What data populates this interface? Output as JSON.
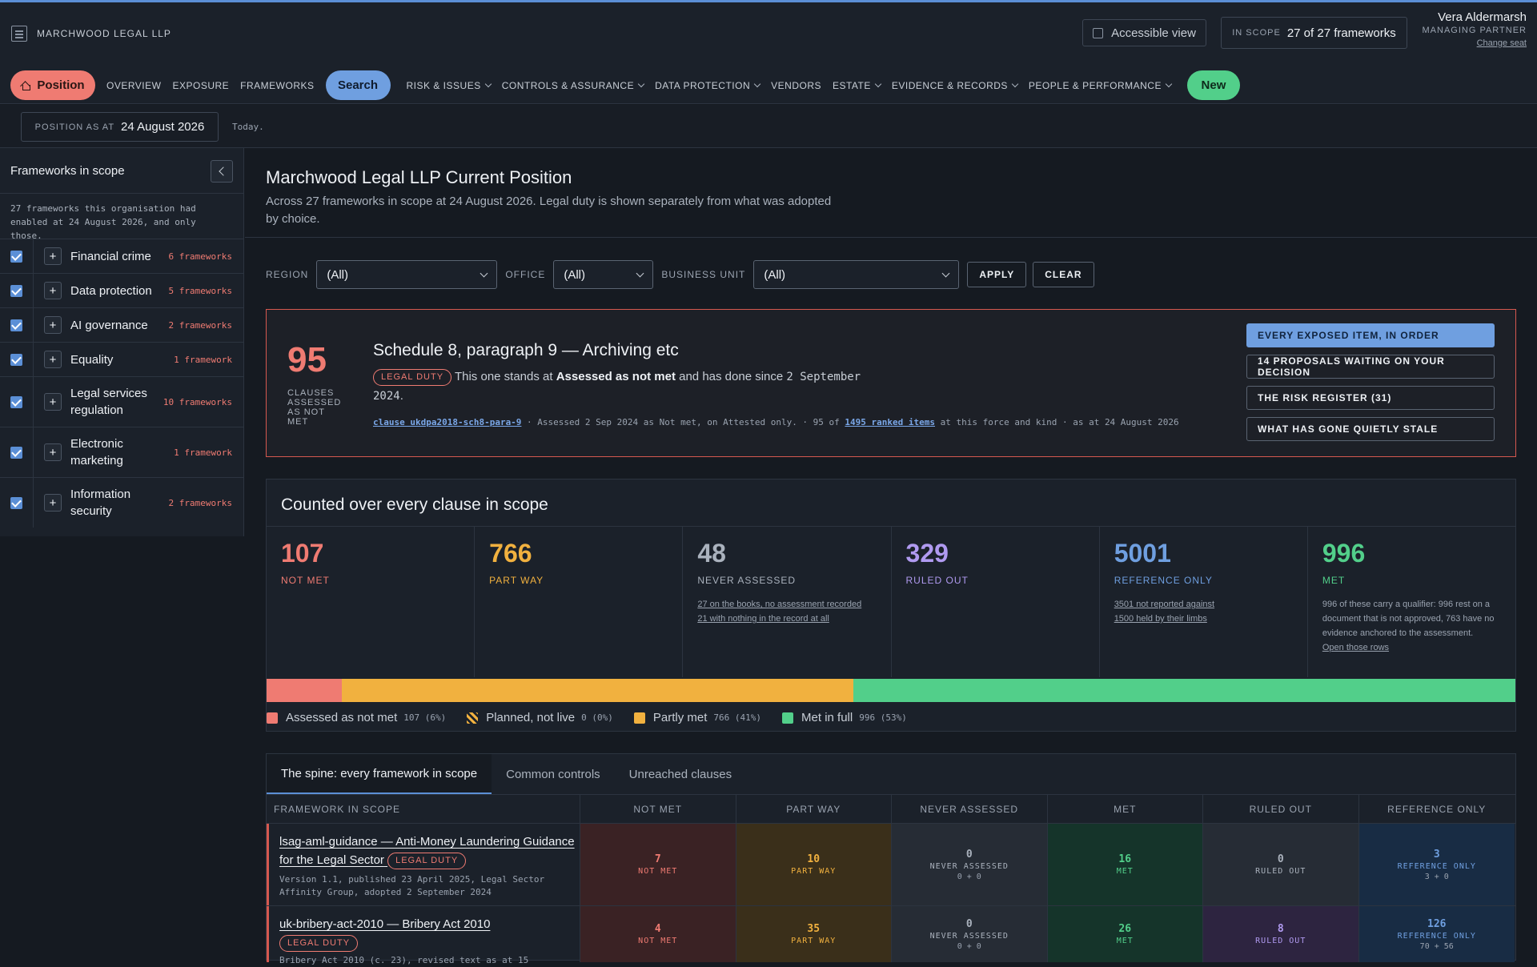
{
  "org": {
    "name": "MARCHWOOD LEGAL LLP"
  },
  "header": {
    "accessible": "Accessible view",
    "scope_label": "IN SCOPE",
    "scope_value": "27 of 27 frameworks",
    "user_name": "Vera Aldermarsh",
    "user_role": "MANAGING PARTNER",
    "change_seat": "Change seat"
  },
  "nav": {
    "position": "Position",
    "overview": "OVERVIEW",
    "exposure": "EXPOSURE",
    "frameworks": "FRAMEWORKS",
    "search": "Search",
    "risk": "RISK & ISSUES",
    "controls": "CONTROLS & ASSURANCE",
    "dp": "DATA PROTECTION",
    "vendors": "VENDORS",
    "estate": "ESTATE",
    "evidence": "EVIDENCE & RECORDS",
    "people": "PEOPLE & PERFORMANCE",
    "new": "New"
  },
  "position": {
    "label": "POSITION AS AT",
    "date": "24 August 2026",
    "today": "Today."
  },
  "sidebar": {
    "title": "Frameworks in scope",
    "note": "27 frameworks this organisation had enabled at 24 August 2026, and only those.",
    "items": [
      {
        "name": "Financial crime",
        "count": "6 frameworks"
      },
      {
        "name": "Data protection",
        "count": "5 frameworks"
      },
      {
        "name": "AI governance",
        "count": "2 frameworks"
      },
      {
        "name": "Equality",
        "count": "1 framework"
      },
      {
        "name": "Legal services regulation",
        "count": "10 frameworks"
      },
      {
        "name": "Electronic marketing",
        "count": "1 framework"
      },
      {
        "name": "Information security",
        "count": "2 frameworks"
      }
    ]
  },
  "main": {
    "title": "Marchwood Legal LLP Current Position",
    "subtitle": "Across 27 frameworks in scope at 24 August 2026. Legal duty is shown separately from what was adopted by choice."
  },
  "filters": {
    "region_label": "REGION",
    "region": "(All)",
    "office_label": "OFFICE",
    "office": "(All)",
    "bu_label": "BUSINESS UNIT",
    "bu": "(All)",
    "apply": "APPLY",
    "clear": "CLEAR"
  },
  "feature": {
    "number": "95",
    "caption": "CLAUSES ASSESSED AS NOT MET",
    "heading": "Schedule 8, paragraph 9 — Archiving etc",
    "badge": "LEGAL DUTY",
    "line_a": "This one stands at ",
    "line_b": "Assessed as not met",
    "line_c": " and has done since ",
    "line_d": "2 September 2024",
    "line_e": ".",
    "meta_link": "clause ukdpa2018-sch8-para-9",
    "meta_mid": " · Assessed 2 Sep 2024 as Not met, on Attested only. · 95 of ",
    "meta_link2": "1495 ranked items",
    "meta_end": " at this force and kind · as at 24 August 2026",
    "actions": [
      "EVERY EXPOSED ITEM, IN ORDER",
      "14 PROPOSALS WAITING ON YOUR DECISION",
      "THE RISK REGISTER (31)",
      "WHAT HAS GONE QUIETLY STALE"
    ]
  },
  "counted": {
    "title": "Counted over every clause in scope",
    "cols": [
      {
        "value": "107",
        "label": "NOT MET",
        "color": "#ef7b72"
      },
      {
        "value": "766",
        "label": "PART WAY",
        "color": "#f1b13f"
      },
      {
        "value": "48",
        "label": "NEVER ASSESSED",
        "color": "#aab2bd",
        "d1": "27 on the books, no assessment recorded",
        "d2": "21 with nothing in the record at all"
      },
      {
        "value": "329",
        "label": "RULED OUT",
        "color": "#b09af0"
      },
      {
        "value": "5001",
        "label": "REFERENCE ONLY",
        "color": "#6f9fe0",
        "d1": "3501 not reported against",
        "d2": "1500 held by their limbs"
      },
      {
        "value": "996",
        "label": "MET",
        "color": "#52cf8a",
        "d": "996 of these carry a qualifier: 996 rest on a document that is not approved, 763 have no evidence anchored to the assessment.",
        "d_link": "Open those rows"
      }
    ],
    "bar": [
      {
        "label": "Assessed as not met",
        "count": "107 (6%)",
        "share": 6,
        "color": "#ef7b72"
      },
      {
        "label": "Planned, not live",
        "count": "0 (0%)",
        "share": 0,
        "color": "#f1b13f"
      },
      {
        "label": "Partly met",
        "count": "766 (41%)",
        "share": 41,
        "color": "#f1b13f"
      },
      {
        "label": "Met in full",
        "count": "996 (53%)",
        "share": 53,
        "color": "#52cf8a"
      }
    ]
  },
  "tabs": {
    "t1": "The spine: every framework in scope",
    "t2": "Common controls",
    "t3": "Unreached clauses"
  },
  "table": {
    "headers": [
      "FRAMEWORK IN SCOPE",
      "NOT MET",
      "PART WAY",
      "NEVER ASSESSED",
      "MET",
      "RULED OUT",
      "REFERENCE ONLY"
    ],
    "rows": [
      {
        "name": "lsag-aml-guidance — Anti-Money Laundering Guidance for the Legal Sector",
        "badge": "LEGAL DUTY",
        "desc": "Version 1.1, published 23 April 2025, Legal Sector Affinity Group, adopted 2 September 2024",
        "cells": [
          {
            "v": "7",
            "l": "NOT MET"
          },
          {
            "v": "10",
            "l": "PART WAY"
          },
          {
            "v": "0",
            "l": "NEVER ASSESSED",
            "s": "0 + 0"
          },
          {
            "v": "16",
            "l": "MET"
          },
          {
            "v": "0",
            "l": "RULED OUT"
          },
          {
            "v": "3",
            "l": "REFERENCE ONLY",
            "s": "3 + 0"
          }
        ]
      },
      {
        "name": "uk-bribery-act-2010 — Bribery Act 2010",
        "badge": "LEGAL DUTY",
        "desc": "Bribery Act 2010 (c. 23), revised text as at 15",
        "cells": [
          {
            "v": "4",
            "l": "NOT MET"
          },
          {
            "v": "35",
            "l": "PART WAY"
          },
          {
            "v": "0",
            "l": "NEVER ASSESSED",
            "s": "0 + 0"
          },
          {
            "v": "26",
            "l": "MET"
          },
          {
            "v": "8",
            "l": "RULED OUT"
          },
          {
            "v": "126",
            "l": "REFERENCE ONLY",
            "s": "70 + 56"
          }
        ]
      }
    ]
  }
}
